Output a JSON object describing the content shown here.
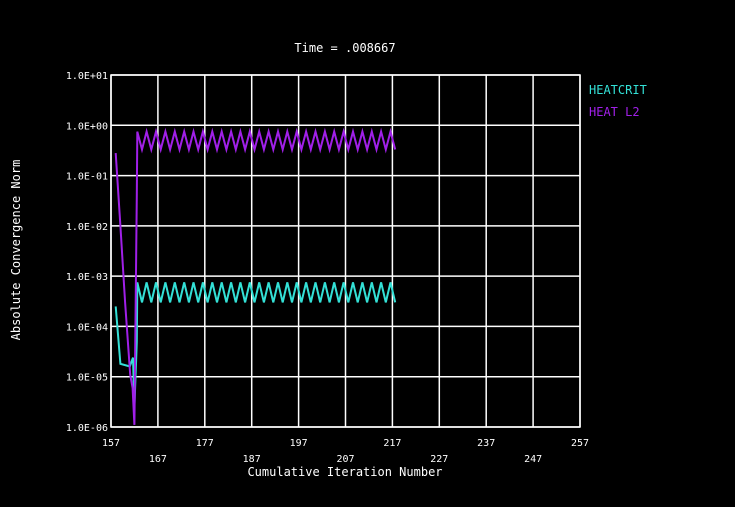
{
  "colors": {
    "background": "#000000",
    "grid": "#ffffff",
    "text": "#ffffff",
    "heatcrit": "#33e0d6",
    "heat_l2": "#a020e8"
  },
  "chart_data": {
    "type": "line",
    "title": "Time = .008667",
    "xlabel": "Cumulative Iteration Number",
    "ylabel": "Absolute Convergence Norm",
    "xlim": [
      157,
      257
    ],
    "ylim": [
      1e-06,
      10
    ],
    "y_scale": "log",
    "grid": true,
    "legend_position": "top-right",
    "x_ticks_lower": [
      "157",
      "177",
      "197",
      "217",
      "237",
      "257"
    ],
    "x_ticks_upper": [
      "167",
      "187",
      "207",
      "227",
      "247"
    ],
    "x_tick_values_lower": [
      157,
      177,
      197,
      217,
      237,
      257
    ],
    "x_tick_values_upper": [
      167,
      187,
      207,
      227,
      247
    ],
    "y_ticks": [
      "1.0E-06",
      "1.0E-05",
      "1.0E-04",
      "1.0E-03",
      "1.0E-02",
      "1.0E-01",
      "1.0E+00",
      "1.0E+01"
    ],
    "y_tick_values": [
      1e-06,
      1e-05,
      0.0001,
      0.001,
      0.01,
      0.1,
      1,
      10
    ],
    "series": [
      {
        "name": "HEATCRIT",
        "initial": [
          [
            158,
            0.00025
          ],
          [
            159,
            1.8e-05
          ],
          [
            161,
            1.6e-05
          ],
          [
            161.7,
            2.4e-05
          ],
          [
            162,
            2.5e-06
          ],
          [
            162.5,
            5e-05
          ],
          [
            162.6,
            0.0007
          ]
        ],
        "oscillation": {
          "start": 162.6,
          "end": 218.5,
          "half_period": 1,
          "high": 0.00075,
          "low": 0.0003
        }
      },
      {
        "name": "HEAT L2",
        "initial": [
          [
            158,
            0.28
          ],
          [
            159,
            0.01
          ],
          [
            160,
            0.0003
          ],
          [
            161.1,
            1.1e-05
          ],
          [
            161.6,
            6e-06
          ],
          [
            162,
            1.1e-06
          ],
          [
            162.5,
            0.04
          ],
          [
            162.6,
            0.7
          ]
        ],
        "oscillation": {
          "start": 162.6,
          "end": 218.5,
          "half_period": 1,
          "high": 0.75,
          "low": 0.33
        }
      }
    ]
  }
}
